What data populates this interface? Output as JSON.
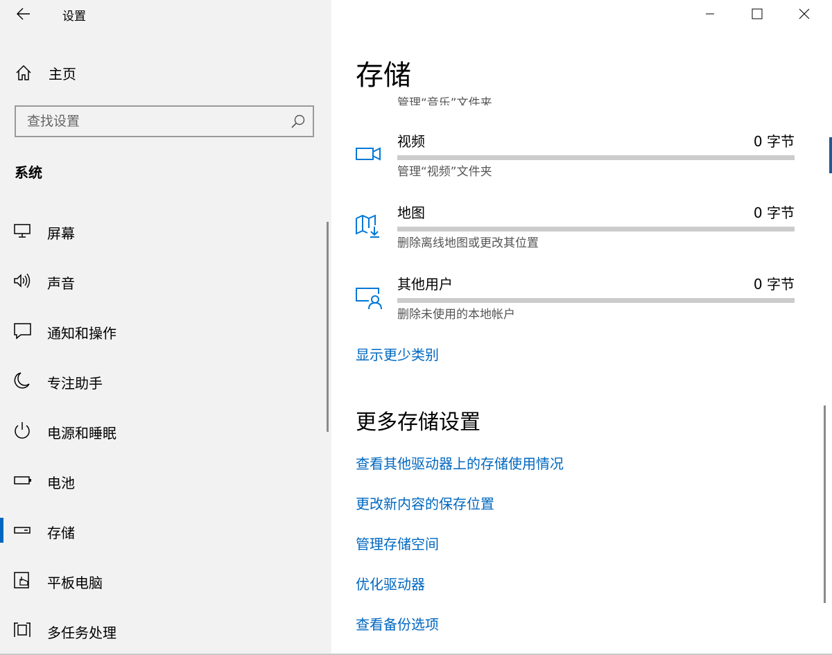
{
  "window": {
    "title": "设置",
    "minimize_icon": "minimize-icon",
    "maximize_icon": "maximize-icon",
    "close_icon": "close-icon"
  },
  "sidebar": {
    "home_label": "主页",
    "search_placeholder": "查找设置",
    "section_title": "系统",
    "items": [
      {
        "label": "屏幕",
        "icon": "display-icon"
      },
      {
        "label": "声音",
        "icon": "speaker-icon"
      },
      {
        "label": "通知和操作",
        "icon": "notification-icon"
      },
      {
        "label": "专注助手",
        "icon": "moon-icon"
      },
      {
        "label": "电源和睡眠",
        "icon": "power-icon"
      },
      {
        "label": "电池",
        "icon": "battery-icon"
      },
      {
        "label": "存储",
        "icon": "storage-icon",
        "active": true
      },
      {
        "label": "平板电脑",
        "icon": "tablet-icon"
      },
      {
        "label": "多任务处理",
        "icon": "multitasking-icon"
      }
    ]
  },
  "main": {
    "title": "存储",
    "cut_text": "管理“音乐”文件夹",
    "categories": [
      {
        "name": "视频",
        "size": "0 字节",
        "desc": "管理“视频”文件夹",
        "icon": "video-icon",
        "fill": 0
      },
      {
        "name": "地图",
        "size": "0 字节",
        "desc": "删除离线地图或更改其位置",
        "icon": "map-icon",
        "fill": 0
      },
      {
        "name": "其他用户",
        "size": "0 字节",
        "desc": "删除未使用的本地帐户",
        "icon": "other-users-icon",
        "fill": 0
      }
    ],
    "show_less_link": "显示更少类别",
    "more_title": "更多存储设置",
    "more_links": [
      "查看其他驱动器上的存储使用情况",
      "更改新内容的保存位置",
      "管理存储空间",
      "优化驱动器",
      "查看备份选项"
    ]
  },
  "colors": {
    "accent": "#0067c0",
    "icon_blue": "#0078d7",
    "sidebar_bg": "#f2f2f2",
    "bar_track": "#cccccc"
  }
}
